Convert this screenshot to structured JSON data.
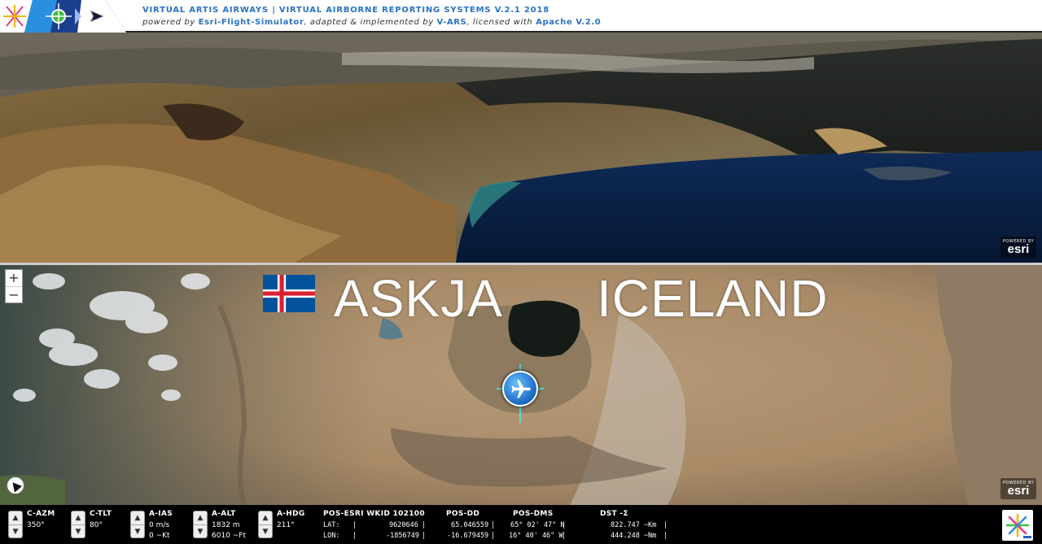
{
  "header": {
    "title": "VIRTUAL ARTIS AIRWAYS | VIRTUAL AIRBORNE REPORTING SYSTEMS V.2.1 2018",
    "sub_prefix": "powered by ",
    "sub_link1": "Esri-Flight-Simulator",
    "sub_mid": ", adapted & implemented by ",
    "sub_link2": "V-ARS",
    "sub_mid2": ", licensed with ",
    "sub_link3": "Apache V.2.0"
  },
  "esri_badge": {
    "powered": "POWERED BY",
    "brand": "esri"
  },
  "map": {
    "zoom_in": "+",
    "zoom_out": "−",
    "place_name": "ASKJA",
    "country": "ICELAND"
  },
  "instruments": {
    "c_azm": {
      "label": "C-AZM",
      "value": "350°"
    },
    "c_tlt": {
      "label": "C-TLT",
      "value": "80°"
    },
    "a_ias": {
      "label": "A-IAS",
      "value1": "0 m/s",
      "value2": "0 ~Kt"
    },
    "a_alt": {
      "label": "A-ALT",
      "value1": "1832 m",
      "value2": "6010 ~Ft"
    },
    "a_hdg": {
      "label": "A-HDG",
      "value": "211°"
    },
    "pos_esri": {
      "label": "POS-ESRI WKID 102100",
      "lat_label": "LAT:",
      "lon_label": "LON:",
      "lat": "9620646",
      "lon": "-1856749"
    },
    "pos_dd": {
      "label": "POS-DD",
      "lat": "65.046559",
      "lon": "-16.679459"
    },
    "pos_dms": {
      "label": "POS-DMS",
      "lat": "65° 02' 47\" N",
      "lon": "16° 40' 46\" W"
    },
    "dst": {
      "label": "DST -Σ",
      "km": "822.747 ~Km",
      "nm": "444.248 ~Nm"
    },
    "spin_up": "▲",
    "spin_down": "▼",
    "sep": "|"
  },
  "colors": {
    "header_link": "#2a72c4",
    "flag_blue": "#02529c",
    "flag_red": "#dc1e35"
  }
}
